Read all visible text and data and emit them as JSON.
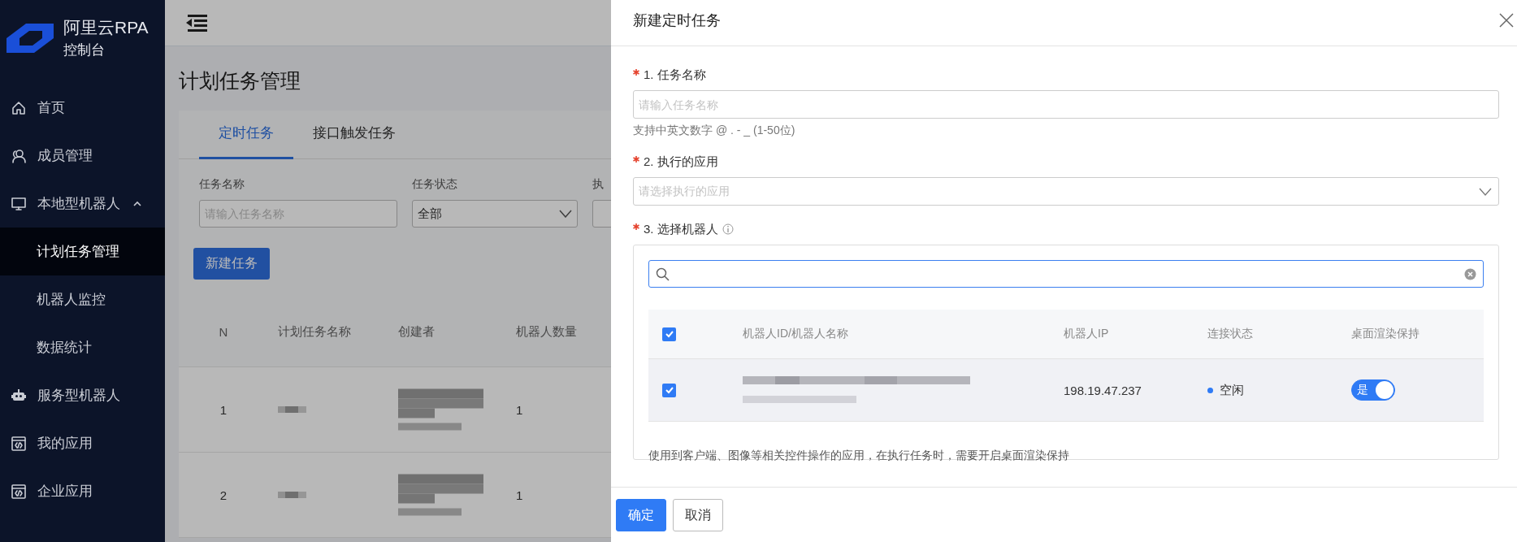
{
  "sidebar": {
    "logo": {
      "title": "阿里云RPA",
      "subtitle": "控制台"
    },
    "items": [
      {
        "label": "首页",
        "selected": false
      },
      {
        "label": "成员管理",
        "selected": false
      },
      {
        "label": "本地型机器人",
        "selected": false,
        "expanded": true,
        "children": [
          {
            "label": "计划任务管理",
            "selected": true
          },
          {
            "label": "机器人监控",
            "selected": false
          },
          {
            "label": "数据统计",
            "selected": false
          }
        ]
      },
      {
        "label": "服务型机器人",
        "selected": false
      },
      {
        "label": "我的应用",
        "selected": false
      },
      {
        "label": "企业应用",
        "selected": false
      }
    ]
  },
  "page": {
    "title": "计划任务管理",
    "tabs": [
      {
        "label": "定时任务",
        "selected": true
      },
      {
        "label": "接口触发任务",
        "selected": false
      }
    ],
    "filters": [
      {
        "kind": "input",
        "label": "任务名称",
        "placeholder": "请输入任务名称"
      },
      {
        "kind": "select",
        "label": "任务状态",
        "value": "全部"
      },
      {
        "kind": "cut",
        "label": "执"
      }
    ],
    "new_button": "新建任务",
    "table": {
      "columns": [
        "N",
        "计划任务名称",
        "创建者",
        "机器人数量"
      ],
      "rows": [
        {
          "n": "1",
          "robot_count": "1"
        },
        {
          "n": "2",
          "robot_count": "1"
        }
      ]
    }
  },
  "drawer": {
    "title": "新建定时任务",
    "fields": [
      {
        "kind": "input",
        "required": true,
        "label": "1. 任务名称",
        "placeholder": "请输入任务名称",
        "hint": "支持中英文数字 @ . - _ (1-50位)"
      },
      {
        "kind": "select",
        "required": true,
        "label": "2. 执行的应用",
        "placeholder": "请选择执行的应用"
      }
    ],
    "robots": {
      "required": true,
      "label": "3. 选择机器人",
      "columns": [
        "机器人ID/机器人名称",
        "机器人IP",
        "连接状态",
        "桌面渲染保持"
      ],
      "all_checked": true,
      "rows": [
        {
          "checked": true,
          "ip": "198.19.47.237",
          "status": "空闲",
          "color": "#2f7bf5",
          "keep_render": {
            "label": "是",
            "on": true
          }
        }
      ],
      "note": "使用到客户端、图像等相关控件操作的应用，在执行任务时，需要开启桌面渲染保持"
    },
    "buttons": [
      {
        "label": "确定",
        "primary": true
      },
      {
        "label": "取消",
        "primary": false
      }
    ]
  }
}
